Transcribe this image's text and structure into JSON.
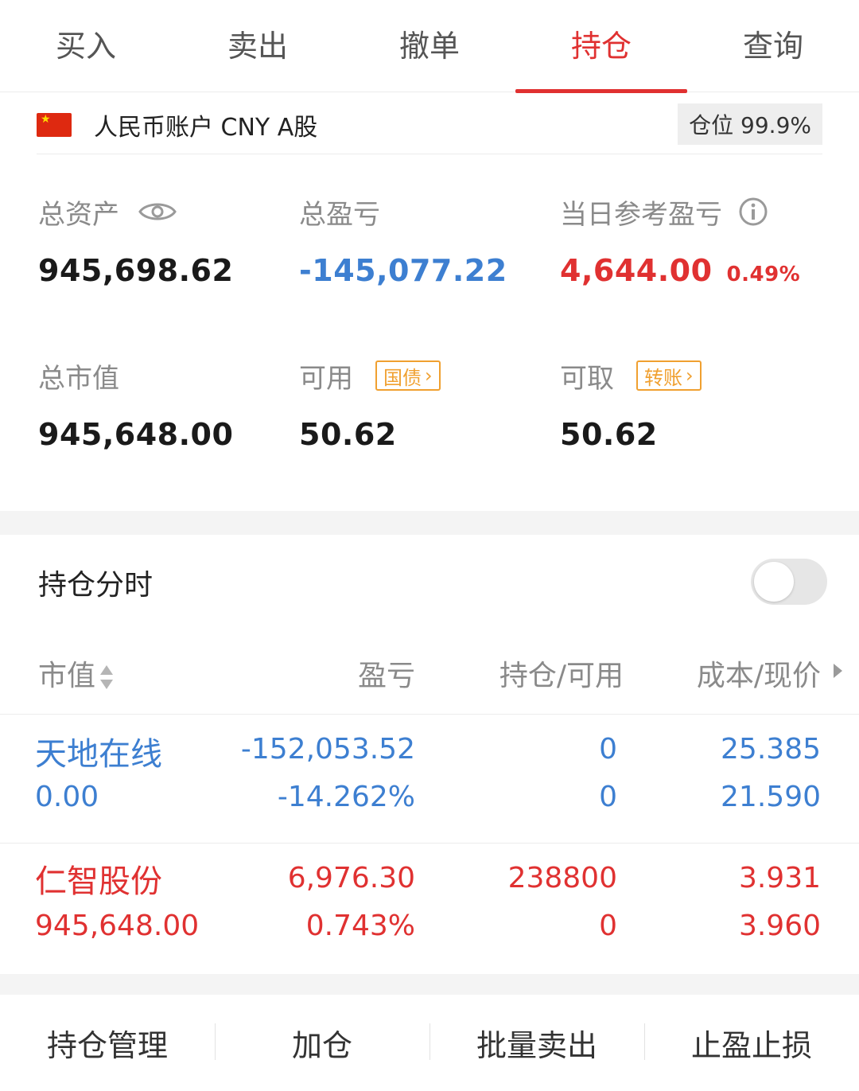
{
  "tabs": [
    {
      "label": "买入"
    },
    {
      "label": "卖出"
    },
    {
      "label": "撤单"
    },
    {
      "label": "持仓"
    },
    {
      "label": "查询"
    }
  ],
  "active_tab": "持仓",
  "account": {
    "label": "人民币账户 CNY A股",
    "position_label": "仓位 99.9%"
  },
  "summary": {
    "total_assets_label": "总资产",
    "total_assets": "945,698.62",
    "total_pnl_label": "总盈亏",
    "total_pnl": "-145,077.22",
    "daily_pnl_label": "当日参考盈亏",
    "daily_pnl": "4,644.00",
    "daily_pnl_pct": "0.49%",
    "market_value_label": "总市值",
    "market_value": "945,648.00",
    "available_label": "可用",
    "available_tag": "国债",
    "available": "50.62",
    "withdrawable_label": "可取",
    "withdrawable_tag": "转账",
    "withdrawable": "50.62"
  },
  "holdings": {
    "title": "持仓分时",
    "toggle_on": false,
    "columns": {
      "market_value": "市值",
      "pnl": "盈亏",
      "position": "持仓/可用",
      "cost_price": "成本/现价"
    },
    "rows": [
      {
        "name": "天地在线",
        "market_value": "0.00",
        "pnl": "-152,053.52",
        "pnl_pct": "-14.262%",
        "position": "0",
        "available": "0",
        "cost": "25.385",
        "price": "21.590"
      },
      {
        "name": "仁智股份",
        "market_value": "945,648.00",
        "pnl": "6,976.30",
        "pnl_pct": "0.743%",
        "position": "238800",
        "available": "0",
        "cost": "3.931",
        "price": "3.960"
      }
    ]
  },
  "actions": [
    {
      "label": "持仓管理"
    },
    {
      "label": "加仓"
    },
    {
      "label": "批量卖出"
    },
    {
      "label": "止盈止损"
    }
  ],
  "colors": {
    "accent_red": "#e03131",
    "loss_blue": "#3d7fd1",
    "tag_orange": "#f0a030"
  }
}
